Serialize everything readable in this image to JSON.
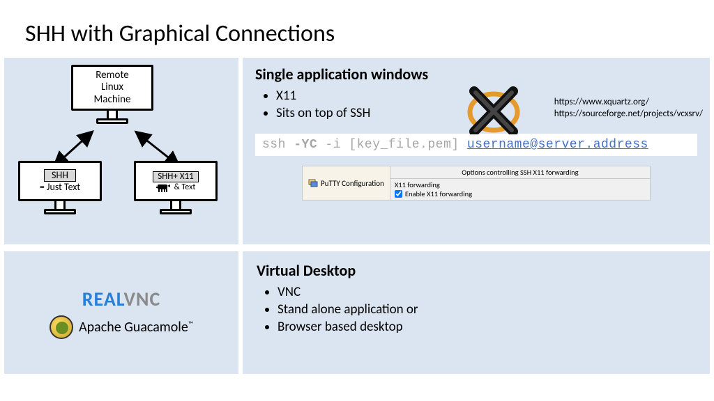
{
  "title": "SHH with Graphical Connections",
  "diagram": {
    "remote": "Remote\nLinux\nMachine",
    "ssh_label1": "SHH",
    "ssh_label2": "= Just Text",
    "sshx11_label1": "SHH+ X11",
    "sshx11_label2": "& Text"
  },
  "top": {
    "heading": "Single application windows",
    "b1": "X11",
    "b2": "Sits on top of SSH",
    "link1": "https://www.xquartz.org/",
    "link2": "https://sourceforge.net/projects/vcxsrv/",
    "cmd_ssh": "ssh ",
    "cmd_flag": "-YC",
    "cmd_rest": " -i [key_file.pem] ",
    "cmd_user": "username@server.address",
    "putty_title": "PuTTY Configuration",
    "putty_opts": "Options controlling SSH X11 forwarding",
    "putty_section": "X11 forwarding",
    "putty_check": "Enable X11 forwarding"
  },
  "bot": {
    "realvnc_a": "REAL",
    "realvnc_b": "VNC",
    "guac": "Apache Guacamole",
    "heading": "Virtual Desktop",
    "b1": "VNC",
    "b2": "Stand alone application or",
    "b3": "Browser based desktop"
  }
}
